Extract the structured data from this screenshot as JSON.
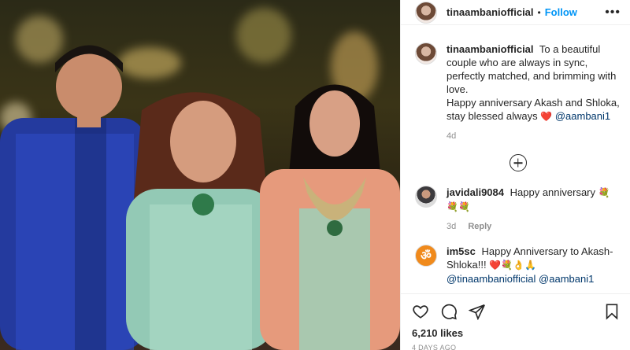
{
  "header": {
    "username": "tinaambaniofficial",
    "separator": "•",
    "follow_label": "Follow",
    "more_label": "•••"
  },
  "caption": {
    "username": "tinaambaniofficial",
    "text": "To a beautiful couple who are always in sync, perfectly matched, and brimming with love.",
    "text2": "Happy anniversary Akash and Shloka, stay blessed always",
    "heart": "❤️",
    "mention": "@aambani1",
    "time": "4d"
  },
  "comments": [
    {
      "username": "javidali9084",
      "text": "Happy anniversary",
      "emoji": "💐💐💐",
      "time": "3d",
      "reply_label": "Reply"
    },
    {
      "username": "im5sc",
      "avatar_glyph": "ॐ",
      "text": "Happy Anniversary to Akash-Shloka!!!",
      "emoji": "❤️💐👌🙏",
      "mention1": "@tinaambaniofficial",
      "mention2": "@aambani1"
    }
  ],
  "footer": {
    "likes": "6,210 likes",
    "date": "4 DAYS AGO"
  },
  "icons": [
    "heart-icon",
    "comment-icon",
    "share-icon",
    "bookmark-icon",
    "more-icon",
    "add-circle-icon"
  ],
  "colors": {
    "link": "#0095f6",
    "mention": "#00376b",
    "muted": "#8e8e8e",
    "text": "#262626"
  }
}
